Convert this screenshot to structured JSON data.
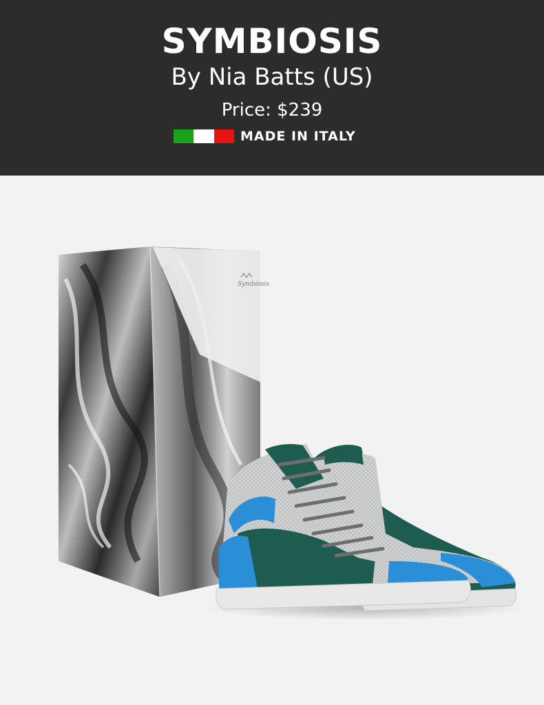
{
  "product": {
    "name": "SYMBIOSIS",
    "designer": "By Nia Batts (US)",
    "price": "Price: $239",
    "origin": "MADE IN ITALY"
  },
  "flag": {
    "colors": [
      "#1aa31a",
      "#ffffff",
      "#e81414"
    ]
  },
  "image": {
    "subject": "shoe-box-and-sneakers",
    "colors": {
      "upper_green": "#1f5c50",
      "accent_blue": "#2a8fd6",
      "snake_grey": "#d4d6d6",
      "laces": "#6e6e6e",
      "sole": "#e8e8e8"
    }
  }
}
